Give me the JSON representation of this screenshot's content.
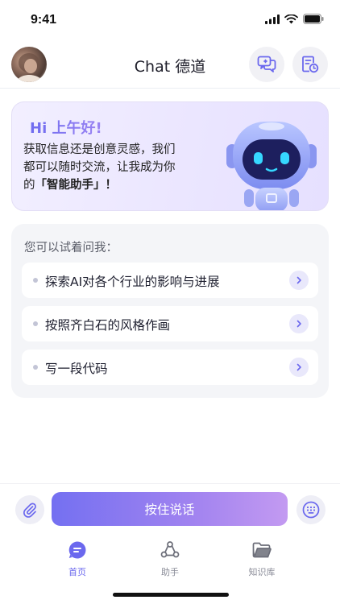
{
  "status_bar": {
    "time": "9:41"
  },
  "header": {
    "title": "Chat 德道"
  },
  "greeting": {
    "title": "Hi 上午好!",
    "line1": "获取信息还是创意灵感，我们",
    "line2": "都可以随时交流，让我成为你",
    "line3_prefix": "的",
    "line3_highlight": "「智能助手」",
    "line3_suffix": "！"
  },
  "suggestions": {
    "heading": "您可以试着问我：",
    "items": [
      {
        "label": "探索AI对各个行业的影响与进展"
      },
      {
        "label": "按照齐白石的风格作画"
      },
      {
        "label": "写一段代码"
      }
    ]
  },
  "input_bar": {
    "hold_to_talk_label": "按住说话"
  },
  "tab_bar": {
    "tabs": [
      {
        "label": "首页",
        "active": true
      },
      {
        "label": "助手",
        "active": false
      },
      {
        "label": "知识库",
        "active": false
      }
    ]
  },
  "colors": {
    "accent": "#6b68ee",
    "accent_gradient_end": "#c39af1",
    "card_bg": "#f4f5f8"
  }
}
